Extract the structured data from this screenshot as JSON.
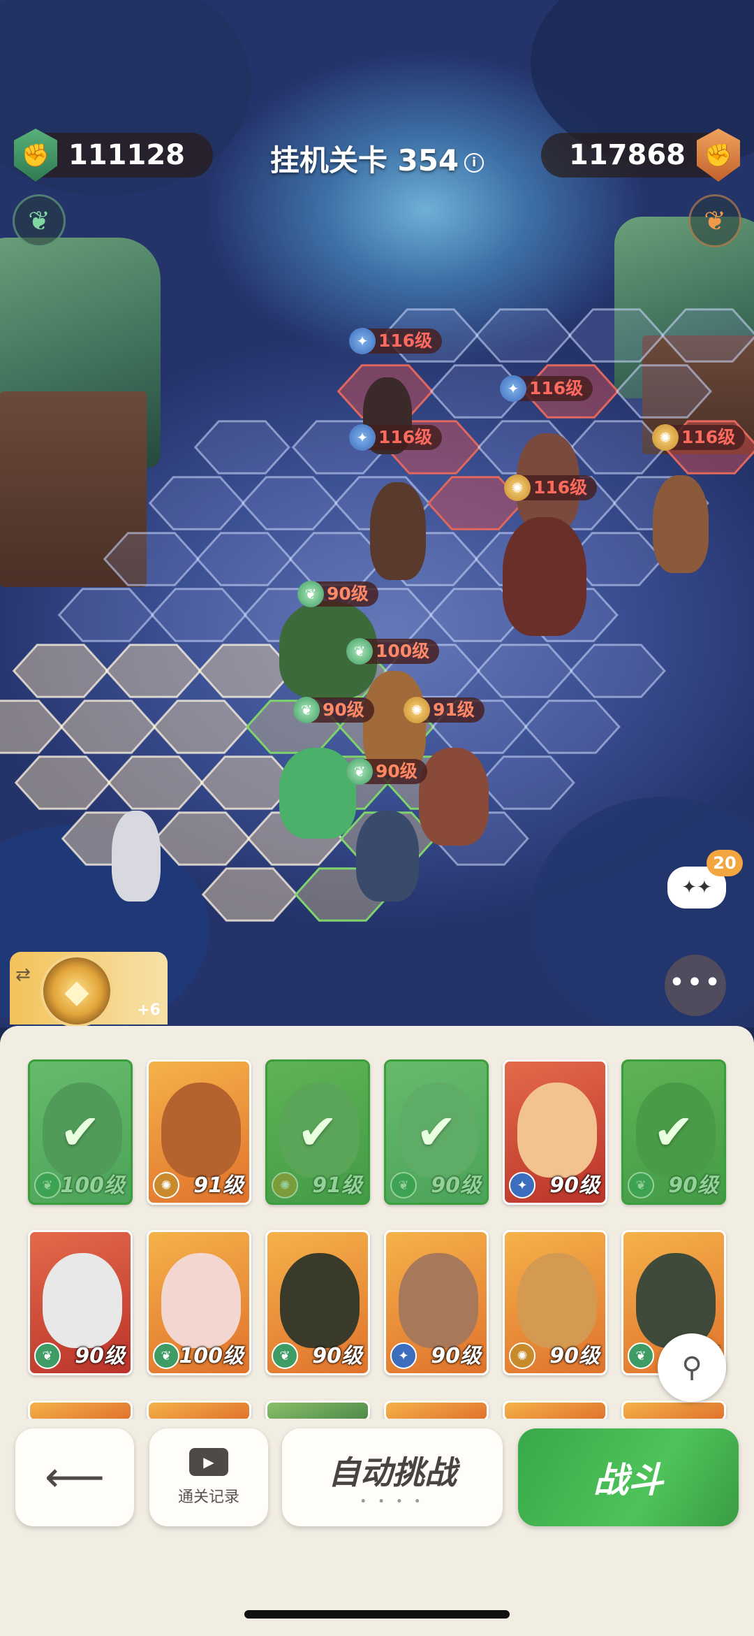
{
  "header": {
    "left_power": "111128",
    "right_power": "117868",
    "stage_title": "挂机关卡 354",
    "info_icon": "i"
  },
  "battlefield": {
    "enemy_levels": [
      "116级",
      "116级",
      "116级",
      "116级",
      "116级"
    ],
    "ally_levels": [
      "90级",
      "100级",
      "90级",
      "91级",
      "90级"
    ],
    "chat_count": "20",
    "more_label": "•••",
    "artifact_bonus": "+6"
  },
  "roster": {
    "row1": [
      {
        "level": "100级",
        "selected": true,
        "faction": "green"
      },
      {
        "level": "91级",
        "selected": false,
        "faction": "gold"
      },
      {
        "level": "91级",
        "selected": true,
        "faction": "gold"
      },
      {
        "level": "90级",
        "selected": true,
        "faction": "green"
      },
      {
        "level": "90级",
        "selected": false,
        "faction": "blue"
      },
      {
        "level": "90级",
        "selected": true,
        "faction": "green"
      }
    ],
    "row2": [
      {
        "level": "90级",
        "faction": "green"
      },
      {
        "level": "100级",
        "faction": "green"
      },
      {
        "level": "90级",
        "faction": "green"
      },
      {
        "level": "90级",
        "faction": "blue"
      },
      {
        "level": "90级",
        "faction": "gold"
      },
      {
        "level": "90级",
        "faction": "green"
      }
    ]
  },
  "actions": {
    "back_icon": "back-arrow-icon",
    "replay_label": "通关记录",
    "auto_label": "自动挑战",
    "auto_dots": "• • • •",
    "fight_label": "战斗"
  },
  "colors": {
    "accent_green": "#3fae4b",
    "enemy_red": "#d94c4c",
    "panel_bg": "#f2ede3"
  }
}
